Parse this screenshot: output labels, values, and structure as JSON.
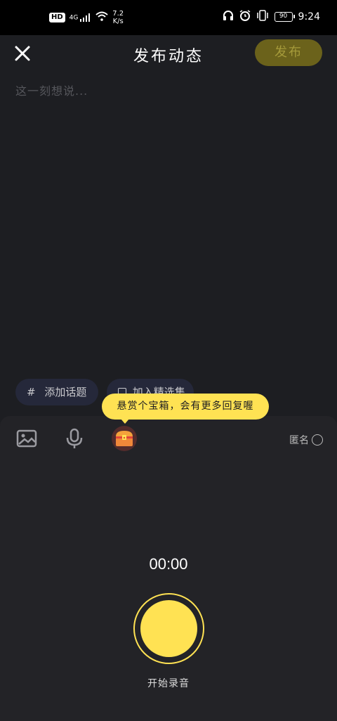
{
  "status_bar": {
    "hd": "HD",
    "signal": "4G",
    "net_speed_value": "7.2",
    "net_speed_unit": "K/s",
    "battery": "90",
    "time": "9:24"
  },
  "header": {
    "title": "发布动态",
    "publish_label": "发布"
  },
  "editor": {
    "placeholder": "这一刻想说..."
  },
  "chips": {
    "topic_icon": "#",
    "topic_label": "添加话题",
    "collection_label": "加入精选集"
  },
  "tooltip": {
    "text": "悬赏个宝箱，会有更多回复喔"
  },
  "toolbar": {
    "anonymous_label": "匿名"
  },
  "recorder": {
    "timer": "00:00",
    "start_label": "开始录音"
  },
  "colors": {
    "accent": "#ffe253",
    "background": "#1d1e22",
    "panel": "#232327"
  }
}
